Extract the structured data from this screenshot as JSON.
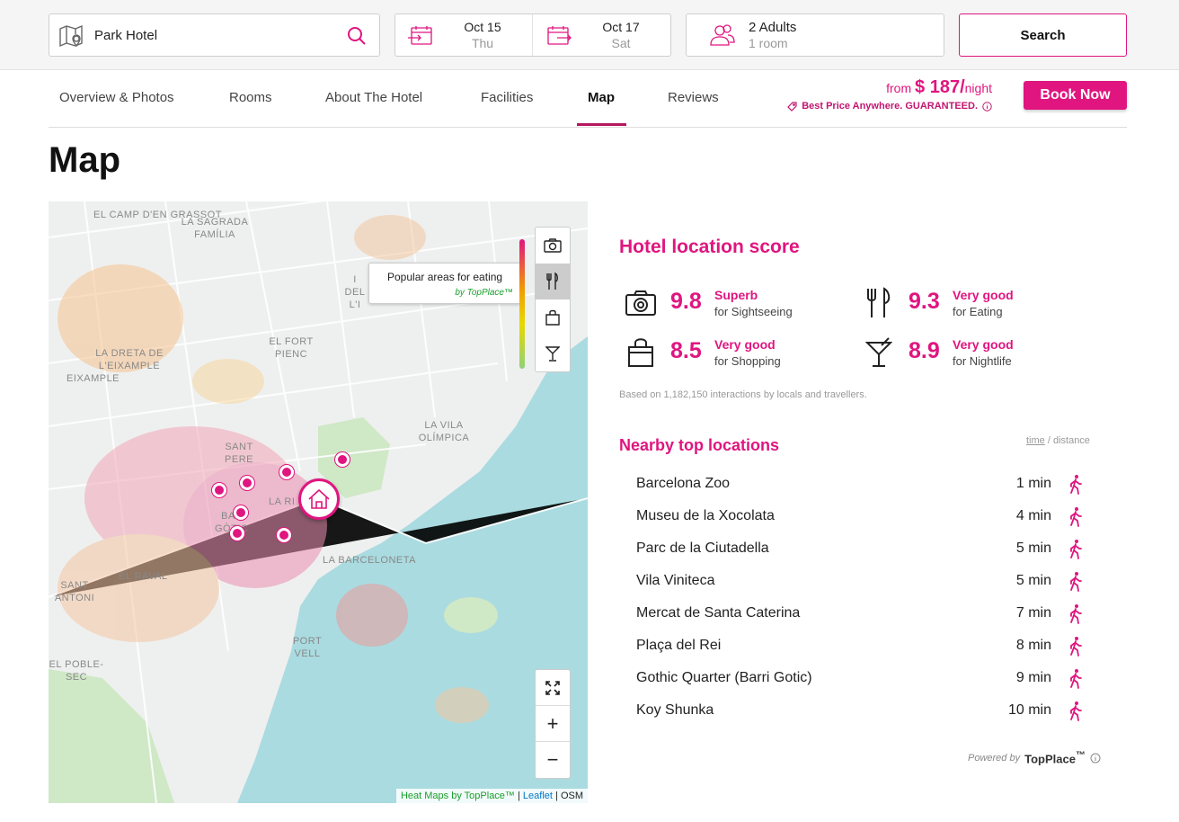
{
  "search": {
    "location": "Park Hotel",
    "checkin_date": "Oct 15",
    "checkin_day": "Thu",
    "checkout_date": "Oct 17",
    "checkout_day": "Sat",
    "guests": "2 Adults",
    "rooms": "1 room",
    "button": "Search"
  },
  "tabs": [
    "Overview & Photos",
    "Rooms",
    "About The Hotel",
    "Facilities",
    "Map",
    "Reviews"
  ],
  "active_tab": "Map",
  "price": {
    "from": "from",
    "amount": "$ 187",
    "per": "/",
    "unit": "night",
    "guarantee": "Best Price Anywhere. GUARANTEED.",
    "book_label": "Book Now"
  },
  "page_title": "Map",
  "map": {
    "labels": [
      "EL CAMP D'EN GRASSOT",
      "LA SAGRADA FAMÍLIA",
      "EL FORT PIENC",
      "LA DRETA DE L'EIXAMPLE",
      "EIXAMPLE",
      "LA VILA OLÍMPICA",
      "SANT PERE",
      "LA RI",
      "BA GÒTIC",
      "EL RAVAL",
      "SANT ANTONI",
      "LA BARCELONETA",
      "PORT VELL",
      "EL POBLE-SEC",
      "I DEL L'I"
    ],
    "tooltip_title": "Popular areas for eating",
    "tooltip_by": "by TopPlace™",
    "attribution_heat": "Heat Maps by TopPlace™",
    "attribution_leaflet": "Leaflet",
    "attribution_osm": "OSM",
    "separator": "|",
    "zoom_in": "+",
    "zoom_out": "−"
  },
  "location_score": {
    "title": "Hotel location score",
    "items": [
      {
        "value": "9.8",
        "label": "Superb",
        "for": "for Sightseeing",
        "icon": "camera-icon"
      },
      {
        "value": "9.3",
        "label": "Very good",
        "for": "for Eating",
        "icon": "fork-knife-icon"
      },
      {
        "value": "8.5",
        "label": "Very good",
        "for": "for Shopping",
        "icon": "shopping-bag-icon"
      },
      {
        "value": "8.9",
        "label": "Very good",
        "for": "for Nightlife",
        "icon": "cocktail-icon"
      }
    ],
    "based_on": "Based on 1,182,150 interactions by locals and travellers."
  },
  "nearby": {
    "title": "Nearby top locations",
    "sort_time": "time",
    "sort_sep": " / ",
    "sort_distance": "distance",
    "items": [
      {
        "name": "Barcelona Zoo",
        "time": "1 min"
      },
      {
        "name": "Museu de la Xocolata",
        "time": "4 min"
      },
      {
        "name": "Parc de la Ciutadella",
        "time": "5 min"
      },
      {
        "name": "Vila Viniteca",
        "time": "5 min"
      },
      {
        "name": "Mercat de Santa Caterina",
        "time": "7 min"
      },
      {
        "name": "Plaça del Rei",
        "time": "8 min"
      },
      {
        "name": "Gothic Quarter (Barri Gotic)",
        "time": "9 min"
      },
      {
        "name": "Koy Shunka",
        "time": "10 min"
      }
    ]
  },
  "powered": {
    "by": "Powered by",
    "brand": "TopPlace",
    "tm": "™"
  },
  "colors": {
    "accent": "#e0157f",
    "accent_dark": "#b5175f",
    "water": "#aadbe0",
    "park": "#cfe8c6"
  }
}
